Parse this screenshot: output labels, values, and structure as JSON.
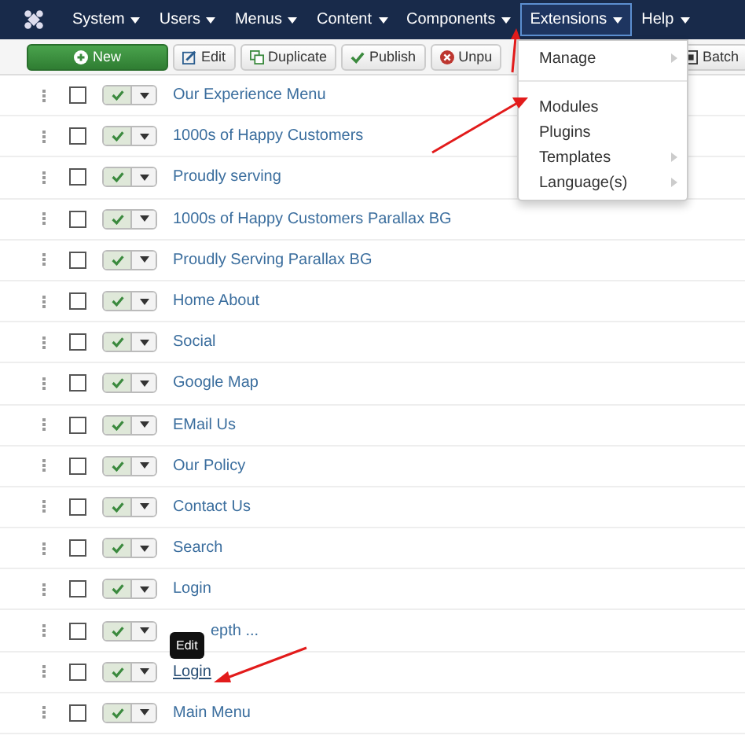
{
  "menu_bar": [
    {
      "label": "System",
      "selected": false
    },
    {
      "label": "Users",
      "selected": false
    },
    {
      "label": "Menus",
      "selected": false
    },
    {
      "label": "Content",
      "selected": false
    },
    {
      "label": "Components",
      "selected": false
    },
    {
      "label": "Extensions",
      "selected": true
    },
    {
      "label": "Help",
      "selected": false
    }
  ],
  "toolbar": [
    {
      "label": "New",
      "kind": "new"
    },
    {
      "label": "Edit",
      "kind": "edit"
    },
    {
      "label": "Duplicate",
      "kind": "duplicate"
    },
    {
      "label": "Publish",
      "kind": "publish"
    },
    {
      "label": "Unpu",
      "kind": "unpublish"
    },
    {
      "label": "Batch",
      "kind": "batch"
    }
  ],
  "dropdown": [
    {
      "label": "Manage",
      "submenu": true
    },
    {
      "kind": "divider"
    },
    {
      "label": "Modules",
      "submenu": false
    },
    {
      "label": "Plugins",
      "submenu": false
    },
    {
      "label": "Templates",
      "submenu": true
    },
    {
      "label": "Language(s)",
      "submenu": true
    }
  ],
  "rows": [
    {
      "title": "Our Experience Menu",
      "published": true,
      "checked": false
    },
    {
      "title": "1000s of Happy Customers",
      "published": true,
      "checked": false
    },
    {
      "title": "Proudly serving",
      "published": true,
      "checked": false
    },
    {
      "title": "1000s of Happy Customers Parallax BG",
      "published": true,
      "checked": false
    },
    {
      "title": "Proudly Serving Parallax BG",
      "published": true,
      "checked": false
    },
    {
      "title": "Home About",
      "published": true,
      "checked": false
    },
    {
      "title": "Social",
      "published": true,
      "checked": false
    },
    {
      "title": "Google Map",
      "published": true,
      "checked": false
    },
    {
      "title": "EMail Us",
      "published": true,
      "checked": false
    },
    {
      "title": "Our Policy",
      "published": true,
      "checked": false
    },
    {
      "title": "Contact Us",
      "published": true,
      "checked": false
    },
    {
      "title": "Search",
      "published": true,
      "checked": false
    },
    {
      "title": "Login",
      "published": true,
      "checked": false
    },
    {
      "title": "epth ...",
      "published": true,
      "checked": false
    },
    {
      "title": "Login",
      "published": true,
      "checked": false,
      "hovered": true
    },
    {
      "title": "Main Menu",
      "published": true,
      "checked": false
    }
  ],
  "tooltip": "Edit"
}
